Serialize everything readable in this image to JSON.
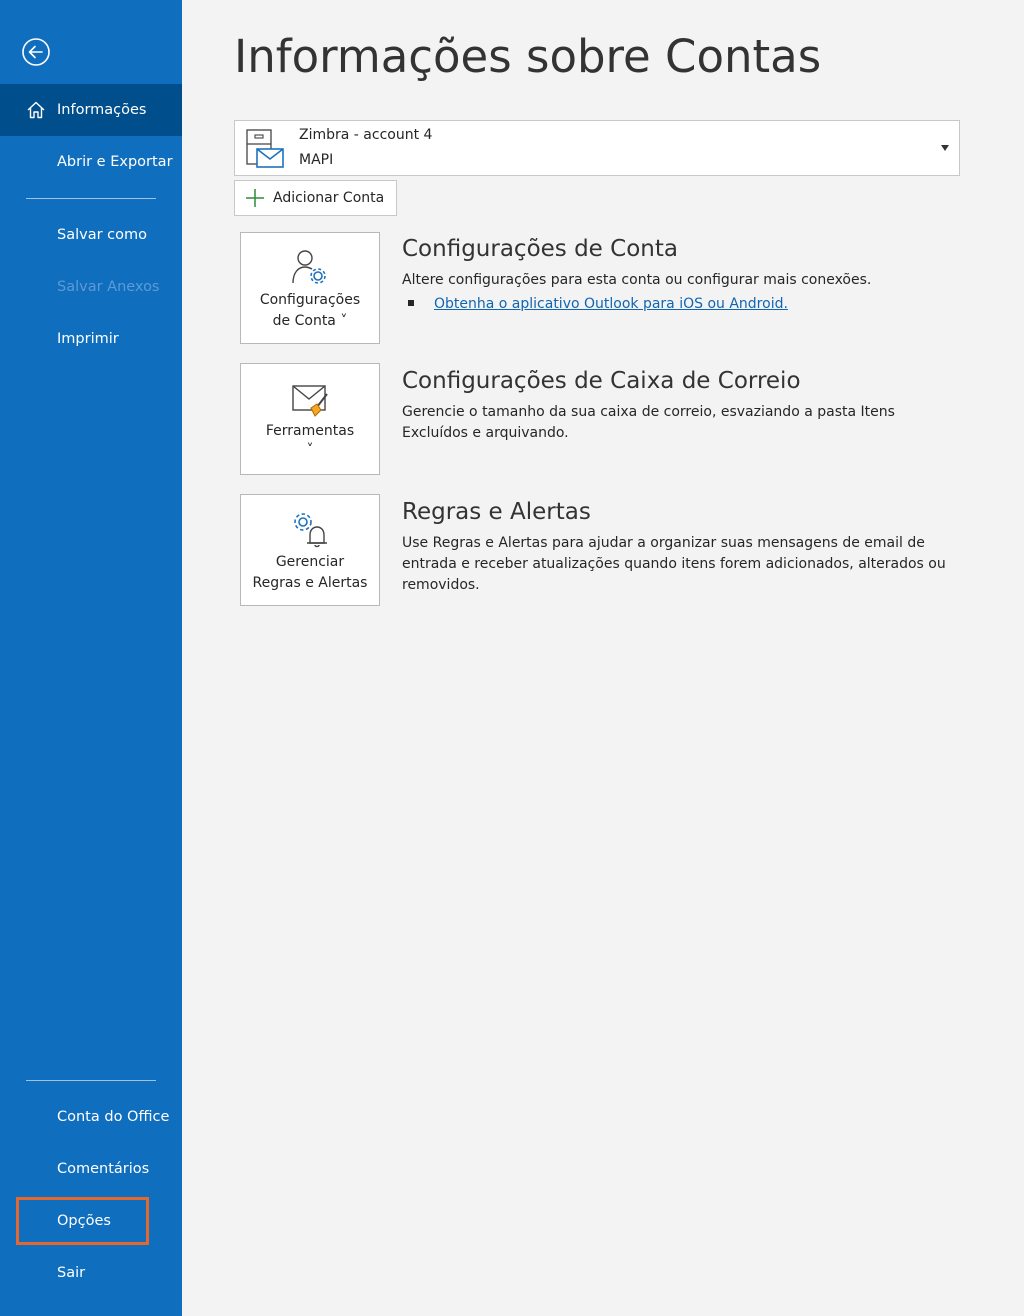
{
  "sidebar": {
    "items": [
      {
        "label": "Informações"
      },
      {
        "label": "Abrir e Exportar"
      },
      {
        "label": "Salvar como"
      },
      {
        "label": "Salvar Anexos"
      },
      {
        "label": "Imprimir"
      }
    ],
    "bottom_items": [
      {
        "label": "Conta do Office"
      },
      {
        "label": "Comentários"
      },
      {
        "label": "Opções"
      },
      {
        "label": "Sair"
      }
    ]
  },
  "main": {
    "title": "Informações sobre Contas",
    "account": {
      "name": "Zimbra - account 4",
      "type": "MAPI"
    },
    "add_account_label": "Adicionar Conta",
    "sections": [
      {
        "tile_label_line1": "Configurações",
        "tile_label_line2": "de Conta ˅",
        "title": "Configurações de Conta",
        "description": "Altere configurações para esta conta ou configurar mais conexões.",
        "link": "Obtenha o aplicativo Outlook para iOS ou Android."
      },
      {
        "tile_label_line1": "Ferramentas",
        "tile_label_line2": "˅",
        "title": "Configurações de Caixa de Correio",
        "description": "Gerencie o tamanho da sua caixa de correio, esvaziando a pasta Itens Excluídos e arquivando."
      },
      {
        "tile_label_line1": "Gerenciar",
        "tile_label_line2": "Regras e Alertas",
        "title": "Regras e Alertas",
        "description": "Use Regras e Alertas para ajudar a organizar suas mensagens de email de entrada e receber atualizações quando itens forem adicionados, alterados ou removidos."
      }
    ]
  },
  "colors": {
    "sidebar": "#106ebe",
    "sidebar_active": "#004e8c",
    "highlight": "#e4672f",
    "link": "#1065b3"
  }
}
